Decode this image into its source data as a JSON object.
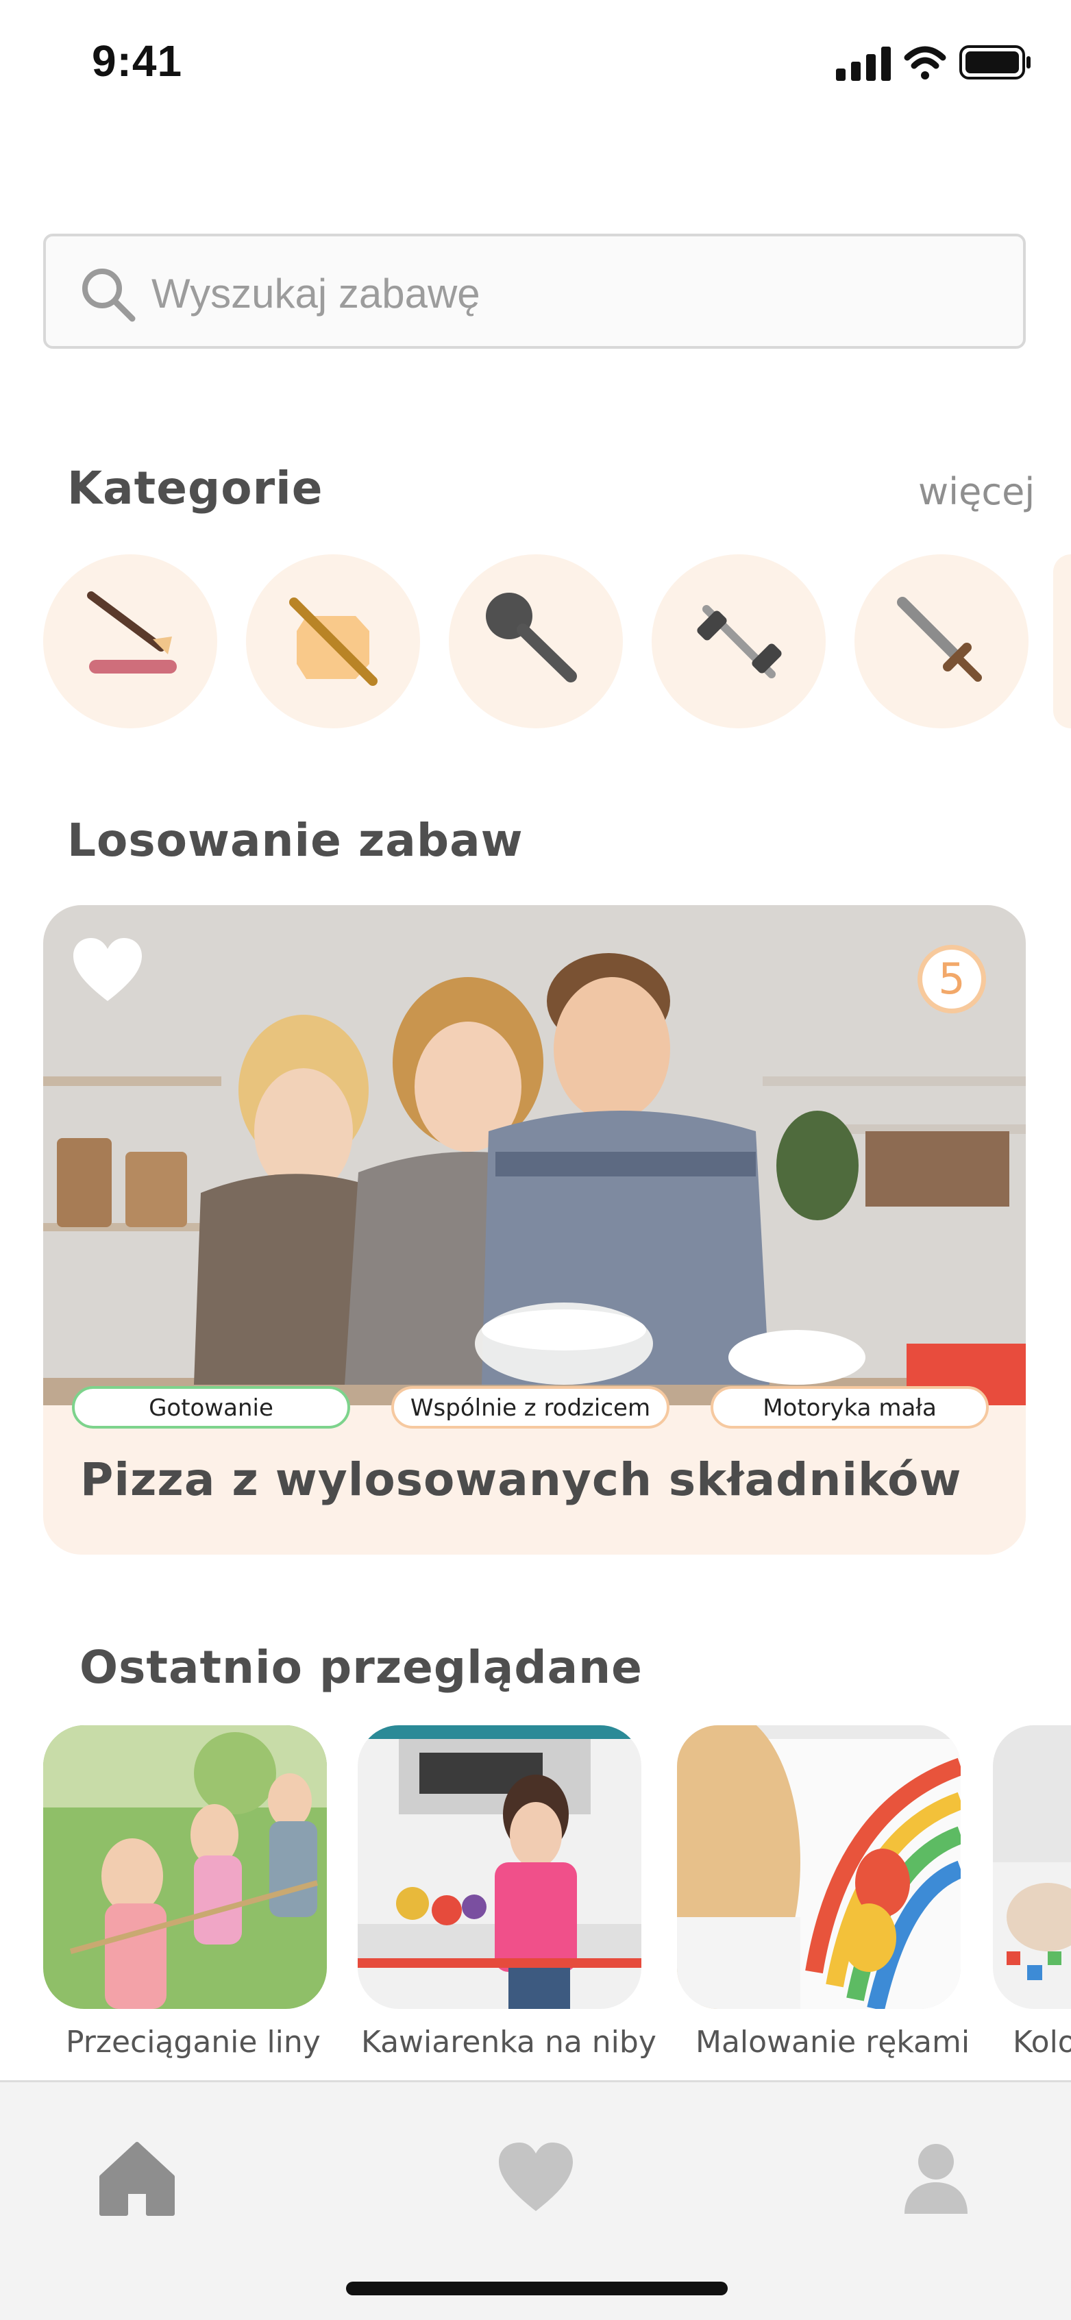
{
  "status_bar": {
    "time": "9:41"
  },
  "search": {
    "placeholder": "Wyszukaj zabawę"
  },
  "categories": {
    "title": "Kategorie",
    "more_label": "więcej",
    "items": [
      {
        "icon": "paintbrush-icon"
      },
      {
        "icon": "rolling-pin-icon"
      },
      {
        "icon": "microphone-icon"
      },
      {
        "icon": "dumbbell-icon"
      },
      {
        "icon": "sword-icon"
      }
    ]
  },
  "random": {
    "title": "Losowanie zabaw",
    "card": {
      "title": "Pizza z wylosowanych składników",
      "count": "5",
      "tags": [
        "Gotowanie",
        "Wspólnie z rodzicem",
        "Motoryka mała"
      ]
    }
  },
  "recent": {
    "title": "Ostatnio przeglądane",
    "items": [
      {
        "label": "Przeciąganie liny"
      },
      {
        "label": "Kawiarenka na niby"
      },
      {
        "label": "Malowanie rękami"
      },
      {
        "label": "Kolo"
      }
    ]
  },
  "tabbar": {
    "icons": [
      "home-icon",
      "heart-icon",
      "user-icon"
    ]
  },
  "colors": {
    "accent": "#f2a869",
    "category_bg": "#fdf2e8",
    "card_bg": "#fdf1e8",
    "tag_green": "#7dd38c",
    "tag_orange": "#f6c9a0"
  }
}
